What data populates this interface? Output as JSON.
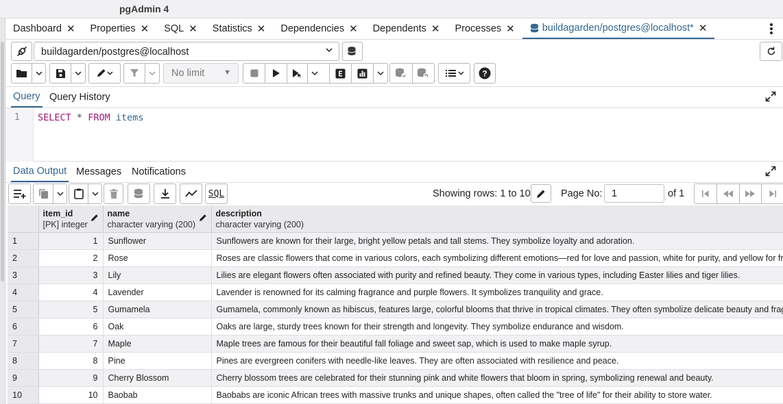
{
  "app": {
    "title": "pgAdmin 4"
  },
  "tabs": [
    {
      "label": "Dashboard"
    },
    {
      "label": "Properties"
    },
    {
      "label": "SQL"
    },
    {
      "label": "Statistics"
    },
    {
      "label": "Dependencies"
    },
    {
      "label": "Dependents"
    },
    {
      "label": "Processes"
    },
    {
      "label": "buildagarden/postgres@localhost*",
      "active": true
    }
  ],
  "connection": {
    "value": "buildagarden/postgres@localhost"
  },
  "toolbar": {
    "row_limit": "No limit"
  },
  "query_tabs": {
    "query": "Query",
    "history": "Query History"
  },
  "editor": {
    "line_number": "1",
    "tokens": {
      "select": "SELECT",
      "star": "*",
      "from": "FROM",
      "table": "items"
    }
  },
  "output_tabs": {
    "data_output": "Data Output",
    "messages": "Messages",
    "notifications": "Notifications"
  },
  "output_toolbar": {
    "sql_label": "SQL",
    "rows_info": "Showing rows: 1 to 10",
    "page_label": "Page No:",
    "page_value": "1",
    "of_pages": "of 1"
  },
  "grid": {
    "columns": [
      {
        "name": "item_id",
        "type": "[PK] integer"
      },
      {
        "name": "name",
        "type": "character varying (200)"
      },
      {
        "name": "description",
        "type": "character varying (200)"
      }
    ],
    "rows": [
      {
        "rn": "1",
        "id": "1",
        "name": "Sunflower",
        "description": "Sunflowers are known for their large, bright yellow petals and tall stems. They symbolize loyalty and adoration."
      },
      {
        "rn": "2",
        "id": "2",
        "name": "Rose",
        "description": "Roses are classic flowers that come in various colors, each symbolizing different emotions—red for love and passion, white for purity, and yellow for frie"
      },
      {
        "rn": "3",
        "id": "3",
        "name": "Lily",
        "description": "Lilies are elegant flowers often associated with purity and refined beauty. They come in various types, including Easter lilies and tiger lilies."
      },
      {
        "rn": "4",
        "id": "4",
        "name": "Lavender",
        "description": "Lavender is renowned for its calming fragrance and purple flowers. It symbolizes tranquility and grace."
      },
      {
        "rn": "5",
        "id": "5",
        "name": "Gumamela",
        "description": "Gumamela, commonly known as hibiscus, features large, colorful blooms that thrive in tropical climates. They often symbolize delicate beauty and fragi"
      },
      {
        "rn": "6",
        "id": "6",
        "name": "Oak",
        "description": "Oaks are large, sturdy trees known for their strength and longevity. They symbolize endurance and wisdom."
      },
      {
        "rn": "7",
        "id": "7",
        "name": "Maple",
        "description": "Maple trees are famous for their beautiful fall foliage and sweet sap, which is used to make maple syrup."
      },
      {
        "rn": "8",
        "id": "8",
        "name": "Pine",
        "description": "Pines are evergreen conifers with needle-like leaves. They are often associated with resilience and peace."
      },
      {
        "rn": "9",
        "id": "9",
        "name": "Cherry Blossom",
        "description": "Cherry blossom trees are celebrated for their stunning pink and white flowers that bloom in spring, symbolizing renewal and beauty."
      },
      {
        "rn": "10",
        "id": "10",
        "name": "Baobab",
        "description": "Baobabs are iconic African trees with massive trunks and unique shapes, often called the \"tree of life\" for their ability to store water."
      }
    ]
  },
  "colors": {
    "accent": "#326690",
    "keyword": "#a2187a",
    "header_bg": "#e9e9ec"
  }
}
